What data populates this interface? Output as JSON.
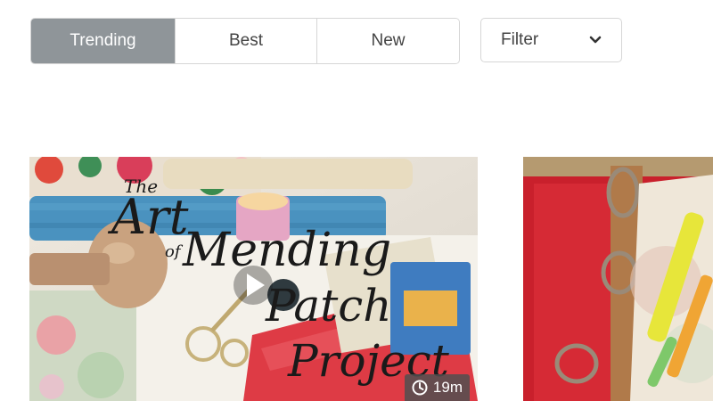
{
  "tabs": [
    {
      "label": "Trending",
      "active": true
    },
    {
      "label": "Best",
      "active": false
    },
    {
      "label": "New",
      "active": false
    }
  ],
  "filter": {
    "label": "Filter",
    "icon": "chevron-down-icon"
  },
  "videos": [
    {
      "title_overlay_lines": [
        "The",
        "Art",
        "of",
        "Mending",
        "Patch",
        "Project"
      ],
      "duration": "19m",
      "icons": [
        "play-icon",
        "clock-icon"
      ]
    },
    {
      "title_overlay_lines": [],
      "duration": ""
    }
  ],
  "colors": {
    "active_tab_bg": "#8f9599",
    "border": "#d6d6d6",
    "duration_bg": "#505050"
  }
}
